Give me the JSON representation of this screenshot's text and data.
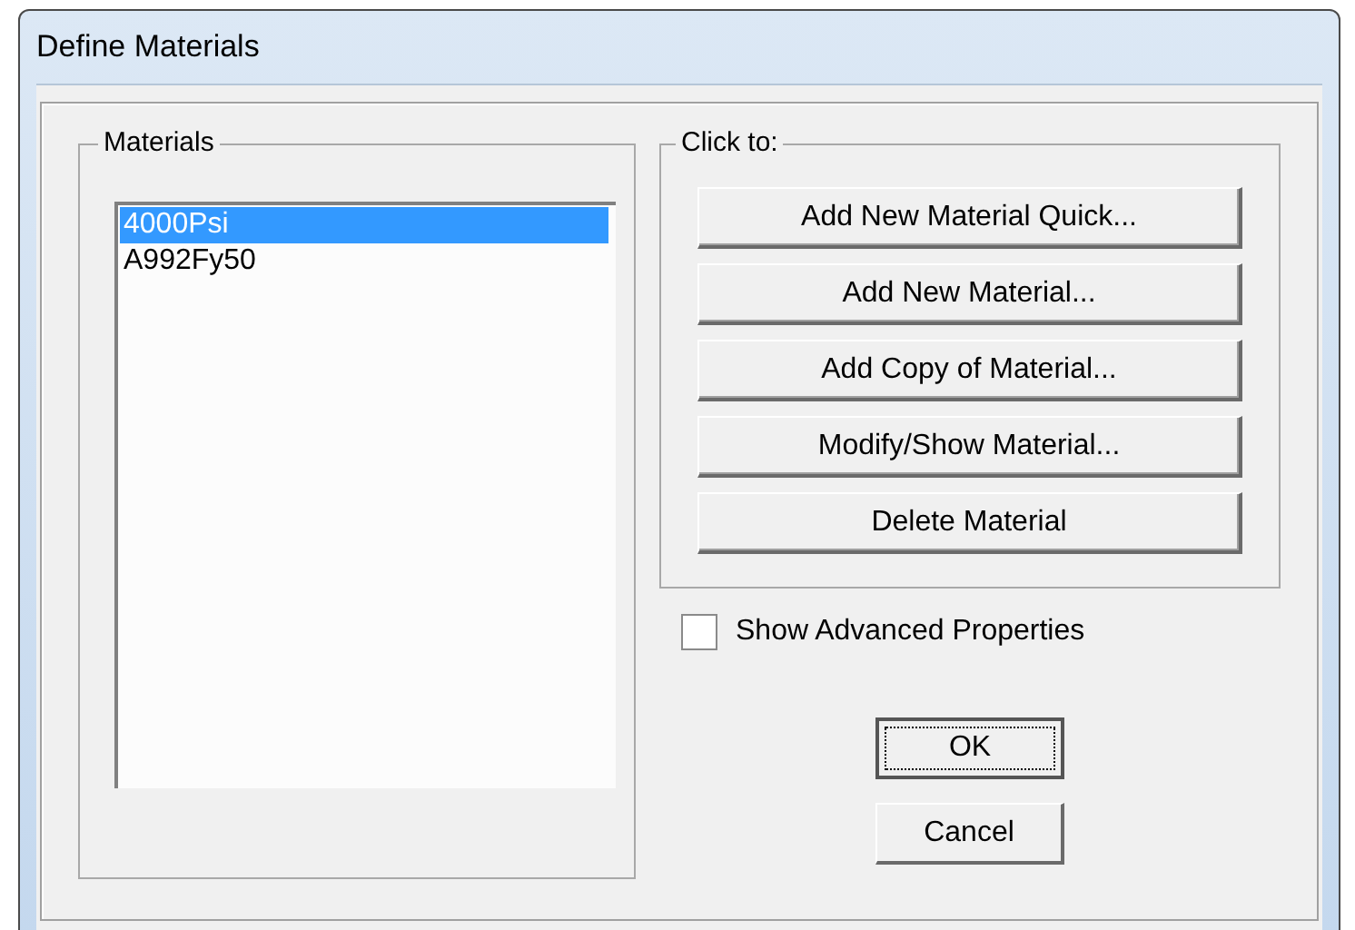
{
  "window": {
    "title": "Define Materials"
  },
  "materials": {
    "label": "Materials",
    "items": [
      {
        "name": "4000Psi",
        "selected": true
      },
      {
        "name": "A992Fy50",
        "selected": false
      }
    ]
  },
  "actions": {
    "label": "Click to:",
    "buttons": [
      "Add New Material Quick...",
      "Add New Material...",
      "Add Copy of Material...",
      "Modify/Show Material...",
      "Delete Material"
    ]
  },
  "show_advanced": {
    "label": "Show Advanced Properties",
    "checked": false
  },
  "buttons": [
    {
      "label": "OK",
      "default": true
    },
    {
      "label": "Cancel",
      "default": false
    }
  ]
}
